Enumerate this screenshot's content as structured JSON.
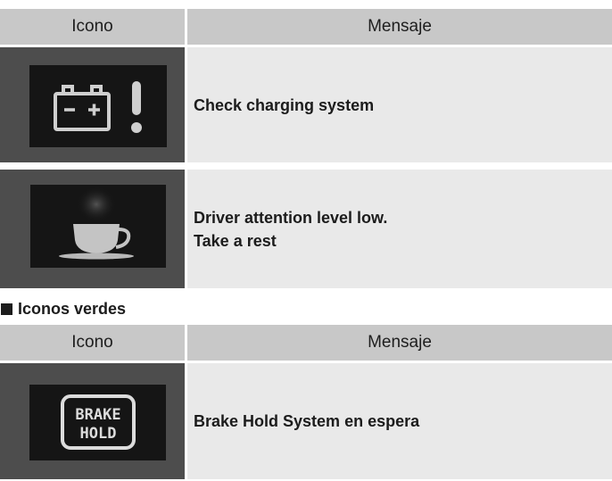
{
  "table1": {
    "header": {
      "icon": "Icono",
      "message": "Mensaje"
    },
    "rows": [
      {
        "icon": "battery-warning-icon",
        "lines": [
          "Check charging system"
        ]
      },
      {
        "icon": "coffee-cup-icon",
        "lines": [
          "Driver attention level low.",
          "Take a rest"
        ]
      }
    ]
  },
  "section": {
    "title": "Iconos verdes"
  },
  "table2": {
    "header": {
      "icon": "Icono",
      "message": "Mensaje"
    },
    "rows": [
      {
        "icon": "brake-hold-icon",
        "icon_text": [
          "BRAKE",
          "HOLD"
        ],
        "lines": [
          "Brake Hold System en espera"
        ]
      }
    ]
  },
  "colors": {
    "header_bg": "#c8c8c8",
    "icon_cell_bg": "#4d4d4d",
    "message_cell_bg": "#e9e9e9",
    "icon_bg": "#151515"
  }
}
